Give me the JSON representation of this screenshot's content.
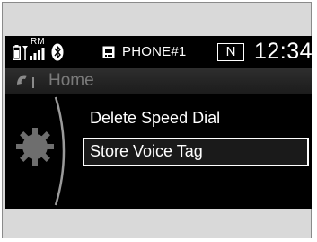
{
  "status_bar": {
    "signal_label": "RM",
    "phone_name": "PHONE#1",
    "gear": "N",
    "time": "12:34"
  },
  "header": {
    "title": "Home"
  },
  "menu": {
    "items": [
      {
        "label": "Delete Speed Dial",
        "selected": false
      },
      {
        "label": "Store Voice Tag",
        "selected": true
      }
    ]
  },
  "colors": {
    "screen_bg": "#000000",
    "text": "#ffffff",
    "title_text": "#7a7a7a",
    "frame_bg": "#d9d9d9"
  },
  "icons": [
    "battery-icon",
    "signal-icon",
    "bluetooth-icon",
    "phone-device-icon",
    "handset-icon",
    "settings-gear-icon"
  ]
}
